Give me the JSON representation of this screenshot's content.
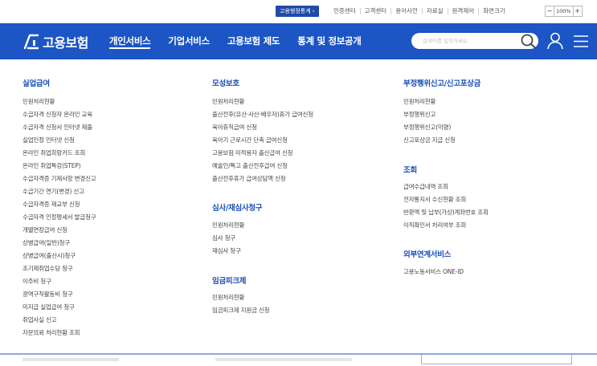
{
  "util_bar": {
    "badge": "고용행정통계 ›",
    "links": [
      "인증센터",
      "고객센터",
      "용어사전",
      "자료실",
      "원격제어",
      "화면크기"
    ],
    "zoom_minus": "−",
    "zoom_value": "100%",
    "zoom_plus": "+"
  },
  "nav": {
    "logo_text": "고용보험",
    "items": [
      "개인서비스",
      "기업서비스",
      "고용보험 제도",
      "통계 및 정보공개"
    ],
    "active_index": 0,
    "search_placeholder": "검색어를 입력하세요.",
    "brand_color": "#1c55c4"
  },
  "menu": {
    "col1": {
      "title": "실업급여",
      "items": [
        "민원처리현황",
        "수급자격 신청자 온라인 교육",
        "수급자격 신청서 인터넷 제출",
        "실업인정 인터넷 신청",
        "온라인 취업희망카드 조회",
        "온라인 취업특강(STEP)",
        "수급자격증 기재사항 변경신고",
        "수급기간 연기(변경) 신고",
        "수급자격증 재교부 신청",
        "수급자격 인정명세서 발급청구",
        "개별연장급여 신청",
        "상병급여(일반)청구",
        "상병급여(출산시)청구",
        "조기재취업수당 청구",
        "이주비 청구",
        "광역구직활동비 청구",
        "미지급 실업급여 청구",
        "취업사실 신고",
        "자문의뢰 처리현황 조회"
      ]
    },
    "col2": {
      "sections": [
        {
          "title": "모성보호",
          "items": [
            "민원처리현황",
            "출산전후(유산·사산·배우자)휴가 급여신청",
            "육아휴직급여 신청",
            "육아기 근로시간 단축 급여신청",
            "고용보험 미적용자 출산급여 신청",
            "예술인/특고 출산전후급여 신청",
            "출산전후휴가 급여상담액 신청"
          ]
        },
        {
          "title": "심사/재심사청구",
          "items": [
            "민원처리현황",
            "심사 청구",
            "재심사 청구"
          ]
        },
        {
          "title": "임금피크제",
          "items": [
            "민원처리현황",
            "임금피크제 지원금 신청"
          ]
        }
      ]
    },
    "col3": {
      "sections": [
        {
          "title": "부정행위신고/신고포상금",
          "items": [
            "민원처리현황",
            "부정행위신고",
            "부정행위신고(익명)",
            "신고포상금 지급 신청"
          ]
        },
        {
          "title": "조회",
          "items": [
            "급여수급내역 조회",
            "전자통지서 수신현황 조회",
            "반환액 및 납부(가상)계좌번호 조회",
            "이직확인서 처리여부 조회"
          ]
        },
        {
          "title": "외부연계서비스",
          "items": [
            "고용노동서비스 ONE-ID"
          ]
        }
      ]
    }
  }
}
